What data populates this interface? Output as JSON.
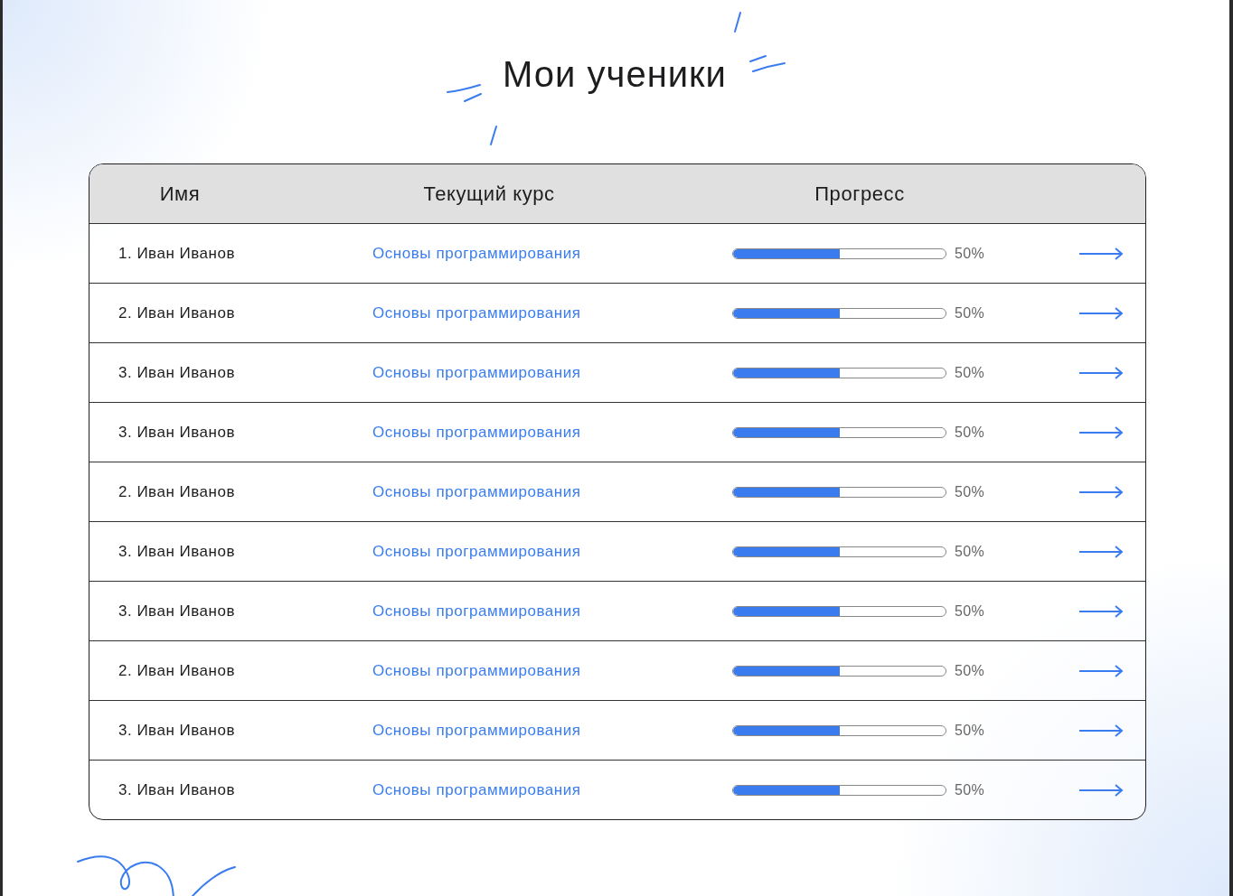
{
  "title": "Мои ученики",
  "table": {
    "columns": [
      "Имя",
      "Текущий курс",
      "Прогресс"
    ],
    "rows": [
      {
        "name": "1. Иван Иванов",
        "course": "Основы программирования",
        "level": 0.5,
        "reading": "50%"
      },
      {
        "name": "2. Иван Иванов",
        "course": "Основы программирования",
        "level": 0.5,
        "reading": "50%"
      },
      {
        "name": "3. Иван Иванов",
        "course": "Основы программирования",
        "level": 0.5,
        "reading": "50%"
      },
      {
        "name": "3. Иван Иванов",
        "course": "Основы программирования",
        "level": 0.5,
        "reading": "50%"
      },
      {
        "name": "2. Иван Иванов",
        "course": "Основы программирования",
        "level": 0.5,
        "reading": "50%"
      },
      {
        "name": "3. Иван Иванов",
        "course": "Основы программирования",
        "level": 0.5,
        "reading": "50%"
      },
      {
        "name": "3. Иван Иванов",
        "course": "Основы программирования",
        "level": 0.5,
        "reading": "50%"
      },
      {
        "name": "2. Иван Иванов",
        "course": "Основы программирования",
        "level": 0.5,
        "reading": "50%"
      },
      {
        "name": "3. Иван Иванов",
        "course": "Основы программирования",
        "level": 0.5,
        "reading": "50%"
      },
      {
        "name": "3. Иван Иванов",
        "course": "Основы программирования",
        "level": 0.5,
        "reading": "50%"
      }
    ]
  }
}
